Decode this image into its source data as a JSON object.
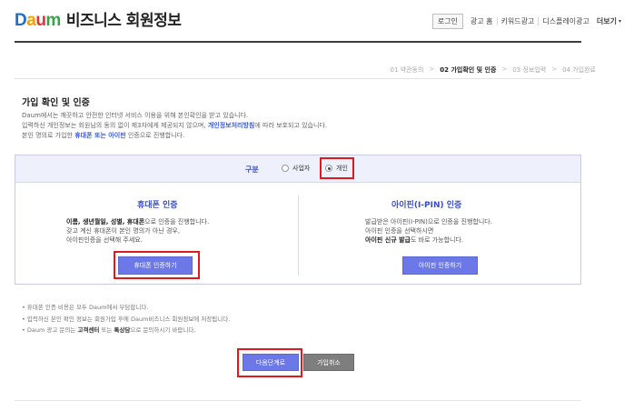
{
  "header": {
    "logo_parts": [
      "D",
      "a",
      "u",
      "m"
    ],
    "title": "비즈니스 회원정보",
    "nav": {
      "login": "로그인",
      "links": [
        "광고 홈",
        "키워드광고",
        "디스플레이광고"
      ],
      "more": "더보기"
    }
  },
  "steps": {
    "items": [
      {
        "label": "01 약관동의",
        "active": false
      },
      {
        "label": "02 가입확인 및 인증",
        "active": true
      },
      {
        "label": "03 정보입력",
        "active": false
      },
      {
        "label": "04 가입완료",
        "active": false
      }
    ],
    "separator": ">"
  },
  "section": {
    "title": "가입 확인 및 인증",
    "line1": "Daum에서는 깨끗하고 안전한 인터넷 서비스 이용을 위해 본인확인을 받고 있습니다.",
    "line2_a": "입력하신 개인정보는 회원님의 동의 없이 제3자에게 제공되지 않으며, ",
    "line2_link": "개인정보처리방침",
    "line2_b": "에 따라 보호되고 있습니다.",
    "line3_a": "본인 명의로 가입한 ",
    "line3_link": "휴대폰 또는 아이핀",
    "line3_b": " 인증으로 진행합니다."
  },
  "type_select": {
    "label": "구분",
    "options": [
      {
        "label": "사업자",
        "checked": false
      },
      {
        "label": "개인",
        "checked": true
      }
    ]
  },
  "phone_auth": {
    "title": "휴대폰 인증",
    "desc1_bold": "이름, 생년월일, 성별, 휴대폰",
    "desc1_rest": "으로 인증을 진행합니다.",
    "desc2": "갖고 계신 휴대폰이 본인 명의가 아닌 경우,",
    "desc3": "아이핀인증을 선택해 주세요.",
    "button": "휴대폰 인증하기"
  },
  "ipin_auth": {
    "title": "아이핀(I-PIN) 인증",
    "desc1": "발급받은 아이핀(I-PIN)으로 인증을 진행합니다.",
    "desc2": "아이핀 인증을 선택하시면",
    "desc3_bold": "아이핀 신규 발급",
    "desc3_rest": "도 바로 가능합니다.",
    "button": "아이핀 인증하기"
  },
  "notes": {
    "n1": "• 휴대폰 인증 비용은 모두 Daum에서 부담합니다.",
    "n2": "• 입력하신 본인 확인 정보는 회원가입 후에 Daum비즈니스 회원정보에 저장됩니다.",
    "n3_a": "• Daum 광고 문의는 ",
    "n3_b1": "고객센터",
    "n3_mid": " 또는 ",
    "n3_b2": "톡상담",
    "n3_c": "으로 문의하시기 바랍니다."
  },
  "actions": {
    "next": "다음단계로",
    "cancel": "가입취소"
  },
  "colors": {
    "accent": "#6c78e8",
    "highlight": "#e0191f",
    "title_blue": "#3b4ec0"
  }
}
